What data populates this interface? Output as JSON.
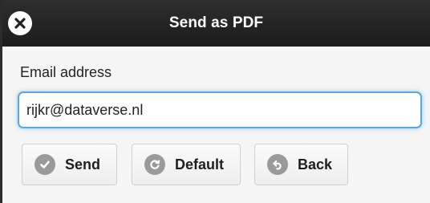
{
  "dialog": {
    "title": "Send as PDF",
    "close_icon": "close-icon"
  },
  "form": {
    "email_label": "Email address",
    "email_value": "rijkr@dataverse.nl",
    "email_placeholder": ""
  },
  "buttons": {
    "send": {
      "label": "Send",
      "icon": "check-icon"
    },
    "default": {
      "label": "Default",
      "icon": "refresh-icon"
    },
    "back": {
      "label": "Back",
      "icon": "back-arrow-icon"
    }
  },
  "colors": {
    "titlebar": "#222222",
    "input_focus": "#5aa7e6",
    "icon_gray": "#9a9a9a"
  }
}
